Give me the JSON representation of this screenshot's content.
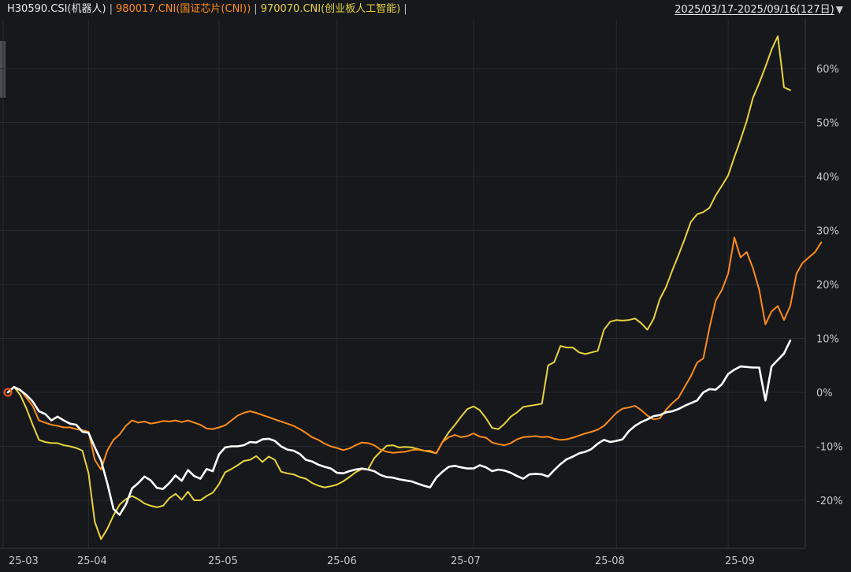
{
  "header": {
    "series_labels": [
      {
        "text": "H30590.CSI(机器人)",
        "color": "#e8e8e8"
      },
      {
        "text": "980017.CNI(国证芯片(CNI))",
        "color": "#ff8c1a"
      },
      {
        "text": "970070.CNI(创业板人工智能)",
        "color": "#e8d43a"
      }
    ],
    "separator": "|",
    "date_range": "2025/03/17-2025/09/16(127日)",
    "dropdown_icon": "triangle-down-icon"
  },
  "chart_data": {
    "type": "line",
    "x_tick_labels": [
      "25-03",
      "25-04",
      "25-05",
      "25-06",
      "25-07",
      "25-08",
      "25-09"
    ],
    "y_ticks": [
      -20,
      -10,
      0,
      10,
      20,
      30,
      40,
      50,
      60
    ],
    "y_tick_labels": [
      "-20%",
      "-10%",
      "0%",
      "10%",
      "20%",
      "30%",
      "40%",
      "50%",
      "60%"
    ],
    "ylim": [
      -30,
      68
    ],
    "n_points": 127,
    "grid": true,
    "series": [
      {
        "name": "H30590.CSI(机器人)",
        "color": "#ffffff",
        "values": [
          0,
          1,
          0.4,
          -0.5,
          -1.7,
          -3.5,
          -4,
          -5.2,
          -4.5,
          -5.2,
          -5.8,
          -6,
          -7.3,
          -7.5,
          -10.2,
          -12.6,
          -16.8,
          -21.6,
          -22.7,
          -20.8,
          -17.8,
          -16.8,
          -15.6,
          -16.3,
          -17.7,
          -17.9,
          -16.8,
          -15.4,
          -16.4,
          -14.4,
          -15.5,
          -16,
          -14.2,
          -14.6,
          -11.5,
          -10.2,
          -10,
          -10,
          -9.8,
          -9.2,
          -9.3,
          -8.7,
          -8.6,
          -9,
          -10,
          -10.6,
          -10.8,
          -11.4,
          -12.5,
          -12.8,
          -13.4,
          -13.8,
          -14.1,
          -14.9,
          -15,
          -14.6,
          -14.3,
          -14.1,
          -14.3,
          -14.6,
          -15.3,
          -15.7,
          -15.8,
          -16.1,
          -16.3,
          -16.5,
          -16.9,
          -17.3,
          -17.6,
          -15.8,
          -14.7,
          -13.8,
          -13.6,
          -13.9,
          -14.1,
          -14.1,
          -13.5,
          -13.9,
          -14.6,
          -14.3,
          -14.5,
          -14.9,
          -15.5,
          -16,
          -15.2,
          -15.1,
          -15.2,
          -15.6,
          -14.4,
          -13.3,
          -12.4,
          -11.9,
          -11.3,
          -11,
          -10.5,
          -9.5,
          -8.8,
          -9.2,
          -9,
          -8.7,
          -7.2,
          -6.2,
          -5.5,
          -5,
          -4.4,
          -4.2,
          -3.7,
          -3.5,
          -3.1,
          -2.5,
          -2,
          -1.5,
          0,
          0.6,
          0.5,
          1.5,
          3.4,
          4.2,
          4.8,
          4.7,
          4.6,
          4.6,
          -1.5,
          4.8,
          6,
          7.2,
          9.6
        ]
      },
      {
        "name": "980017.CNI(国证芯片(CNI))",
        "color": "#ff8c1a",
        "values": [
          0,
          1,
          0.5,
          -1,
          -2.5,
          -5.2,
          -5.6,
          -6,
          -6.2,
          -6.5,
          -6.5,
          -6.8,
          -7,
          -7.3,
          -12.5,
          -14.3,
          -10.8,
          -8.8,
          -7.8,
          -6.2,
          -5.2,
          -5.6,
          -5.4,
          -5.8,
          -5.6,
          -5.3,
          -5.4,
          -5.2,
          -5.5,
          -5.2,
          -5.6,
          -6,
          -6.7,
          -6.8,
          -6.5,
          -6.1,
          -5.2,
          -4.3,
          -3.8,
          -3.5,
          -3.8,
          -4.2,
          -4.6,
          -5,
          -5.4,
          -5.8,
          -6.2,
          -6.8,
          -7.5,
          -8.3,
          -8.8,
          -9.5,
          -10,
          -10.3,
          -10.7,
          -10.4,
          -9.8,
          -9.3,
          -9.4,
          -9.8,
          -10.6,
          -11,
          -11.2,
          -11.1,
          -11,
          -10.7,
          -10.6,
          -10.8,
          -10.8,
          -11.3,
          -9.2,
          -8.3,
          -7.9,
          -8.3,
          -8.1,
          -7.6,
          -8.2,
          -8.4,
          -9.3,
          -9.6,
          -9.8,
          -9.4,
          -8.7,
          -8.3,
          -8.2,
          -8.1,
          -8.3,
          -8.2,
          -8.6,
          -8.8,
          -8.7,
          -8.4,
          -8,
          -7.6,
          -7.3,
          -6.9,
          -6.2,
          -5,
          -3.8,
          -3,
          -2.8,
          -2.5,
          -3.3,
          -4.3,
          -5,
          -4.8,
          -3.2,
          -2,
          -1,
          1,
          3,
          5.5,
          6.3,
          12,
          17,
          19,
          22,
          28.7,
          25,
          26,
          23,
          19,
          12.6,
          15,
          16,
          13.4,
          16,
          22,
          24,
          25,
          26,
          27.8
        ]
      },
      {
        "name": "970070.CNI(创业板人工智能)",
        "color": "#e8d43a",
        "values": [
          0,
          1,
          -0.5,
          -3,
          -6,
          -8.8,
          -9.2,
          -9.4,
          -9.4,
          -9.8,
          -10,
          -10.3,
          -10.8,
          -15,
          -24,
          -27.2,
          -25.3,
          -22.8,
          -20.8,
          -19.8,
          -19.2,
          -19.8,
          -20.6,
          -21,
          -21.3,
          -21,
          -19.6,
          -18.8,
          -19.9,
          -18.4,
          -20,
          -20,
          -19.2,
          -18.6,
          -17,
          -14.8,
          -14.2,
          -13.5,
          -12.7,
          -12.5,
          -11.8,
          -12.9,
          -11.9,
          -12.5,
          -14.7,
          -15,
          -15.2,
          -15.7,
          -16,
          -16.8,
          -17.3,
          -17.6,
          -17.4,
          -17.1,
          -16.5,
          -15.7,
          -14.8,
          -14.2,
          -14.3,
          -12.2,
          -11,
          -9.9,
          -9.8,
          -10.2,
          -10.1,
          -10.2,
          -10.5,
          -10.8,
          -11,
          -11.3,
          -9.2,
          -7.4,
          -6,
          -4.5,
          -3.1,
          -2.6,
          -3.3,
          -4.8,
          -6.6,
          -6.8,
          -5.8,
          -4.5,
          -3.7,
          -2.7,
          -2.5,
          -2.3,
          -2.1,
          5,
          5.6,
          8.6,
          8.3,
          8.3,
          7.4,
          7.1,
          7.4,
          7.7,
          11.6,
          13.1,
          13.4,
          13.3,
          13.4,
          13.7,
          12.8,
          11.6,
          13.6,
          17.3,
          19.5,
          22.6,
          25.4,
          28.4,
          31.6,
          33,
          33.4,
          34.2,
          36.5,
          38.3,
          40.2,
          43.6,
          46.8,
          50.3,
          54.6,
          57.3,
          60.3,
          63.5,
          66,
          56.5,
          56
        ]
      }
    ]
  },
  "side_tab": {
    "label": ""
  }
}
